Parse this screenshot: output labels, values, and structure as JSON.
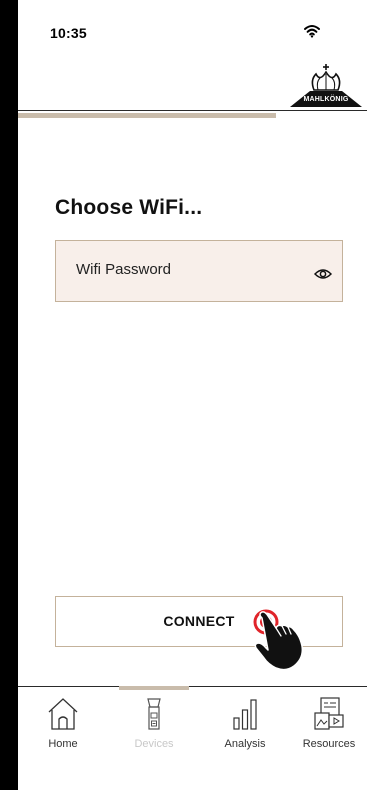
{
  "status_bar": {
    "time": "10:35",
    "wifi_icon": "wifi-icon"
  },
  "header": {
    "logo_text": "MAHLKÖNIG",
    "logo_icon": "crown-logo",
    "progress_fraction": 0.74
  },
  "main": {
    "title": "Choose WiFi...",
    "password_field": {
      "placeholder": "Wifi Password",
      "value": "",
      "toggle_icon": "eye-icon"
    },
    "connect_button": {
      "label": "CONNECT",
      "hint_icon": "tap-hand-icon"
    }
  },
  "bottom_nav": {
    "items": [
      {
        "label": "Home",
        "icon": "home-icon",
        "active": false
      },
      {
        "label": "Devices",
        "icon": "grinder-icon",
        "active": true
      },
      {
        "label": "Analysis",
        "icon": "bar-chart-icon",
        "active": false
      },
      {
        "label": "Resources",
        "icon": "resources-icon",
        "active": false
      }
    ]
  },
  "colors": {
    "accent": "#c9bcab",
    "field_fill": "#f8efea",
    "field_border": "#c4b29b",
    "tap_ring": "#e0242a"
  }
}
